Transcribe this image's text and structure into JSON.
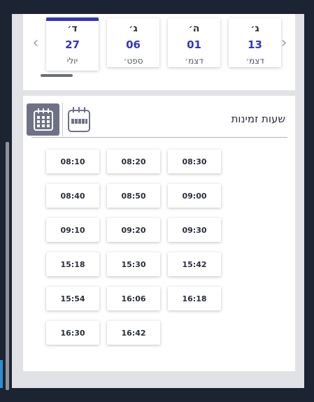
{
  "dates": [
    {
      "dow": "ד׳",
      "day": "27",
      "month": "יולי",
      "selected": true
    },
    {
      "dow": "ג׳",
      "day": "06",
      "month": "ספט׳",
      "selected": false
    },
    {
      "dow": "ה׳",
      "day": "01",
      "month": "דצמ׳",
      "selected": false
    },
    {
      "dow": "ג׳",
      "day": "13",
      "month": "דצמ׳",
      "selected": false
    }
  ],
  "arrows": {
    "prev": "‹",
    "next": "›"
  },
  "times": {
    "title": "שעות זמינות",
    "slots": [
      [
        "08:30",
        "08:20",
        "08:10"
      ],
      [
        "09:00",
        "08:50",
        "08:40"
      ],
      [
        "09:30",
        "09:20",
        "09:10"
      ],
      [
        "15:42",
        "15:30",
        "15:18"
      ],
      [
        "16:18",
        "16:06",
        "15:54"
      ],
      [
        "16:42",
        "16:30"
      ]
    ]
  },
  "view_buttons": {
    "active_icon": "calendar-grid-icon",
    "inactive_icon": "calendar-week-icon"
  },
  "colors": {
    "accent": "#3434c6",
    "active_view_bg": "#6f7286"
  }
}
